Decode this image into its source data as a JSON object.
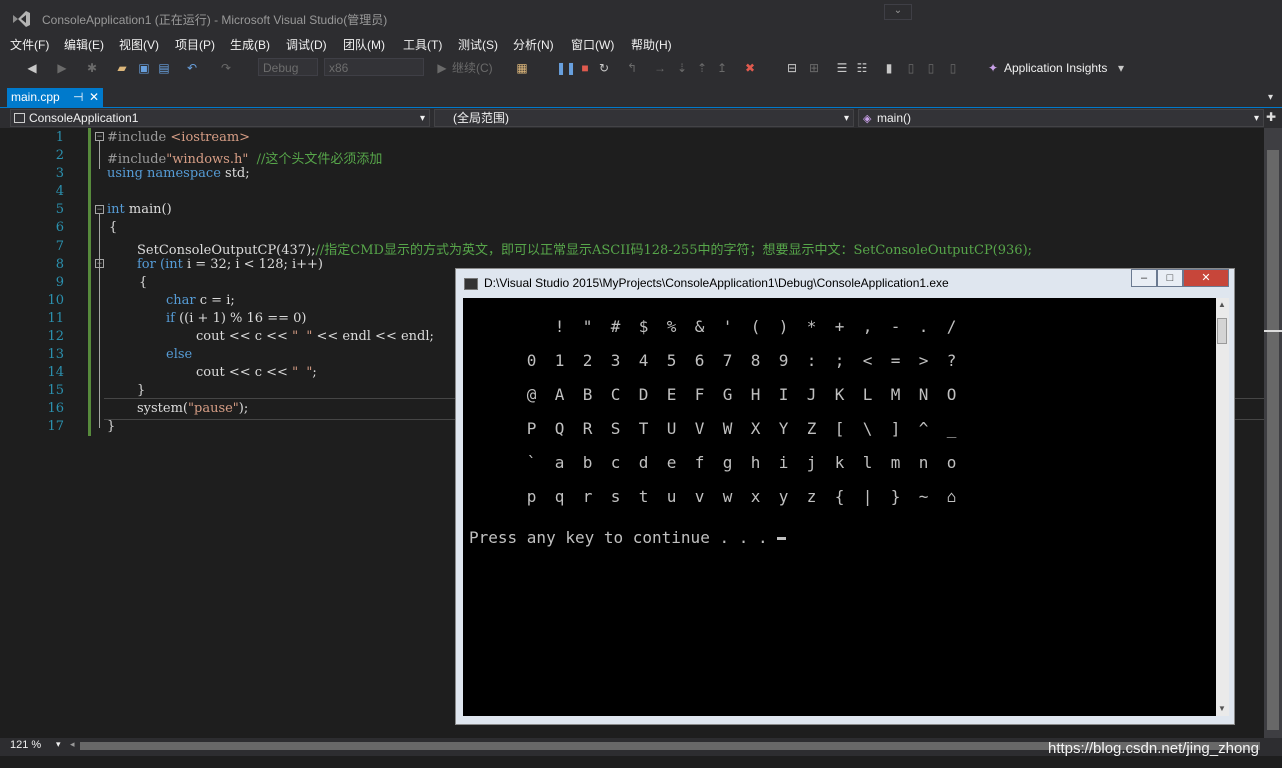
{
  "window": {
    "title": "ConsoleApplication1 (正在运行) - Microsoft Visual Studio(管理员)",
    "collapse_glyph": "⌄"
  },
  "menu": [
    "文件(F)",
    "编辑(E)",
    "视图(V)",
    "项目(P)",
    "生成(B)",
    "调试(D)",
    "团队(M)",
    "工具(T)",
    "测试(S)",
    "分析(N)",
    "窗口(W)",
    "帮助(H)"
  ],
  "toolbar": {
    "config": "Debug",
    "platform": "x86",
    "continue_label": "继续(C)",
    "app_insights": "Application Insights",
    "icons": [
      "back-icon",
      "forward-icon",
      "new-project-icon",
      "open-file-icon",
      "save-icon",
      "save-all-icon",
      "undo-icon",
      "redo-icon",
      "continue-icon",
      "process-icon",
      "pause-icon",
      "stop-icon",
      "restart-icon",
      "step-icon",
      "breakpoint-icon",
      "bookmark-icon",
      "lightbulb-icon"
    ]
  },
  "tab": {
    "label": "main.cpp",
    "pin": "⊣",
    "close": "✕"
  },
  "navbar": {
    "project": "ConsoleApplication1",
    "scope": "(全局范围)",
    "member": "main()"
  },
  "editor": {
    "line_numbers": [
      "1",
      "2",
      "3",
      "4",
      "5",
      "6",
      "7",
      "8",
      "9",
      "10",
      "11",
      "12",
      "13",
      "14",
      "15",
      "16",
      "17"
    ],
    "lines": [
      {
        "text_a": "#include ",
        "text_b": "<iostream>"
      },
      {
        "text_a": "#include",
        "text_b": "\"windows.h\"",
        "text_c": "  //这个头文件必须添加"
      },
      {
        "text_a": "using namespace ",
        "text_b": "std;"
      },
      {
        "text_a": ""
      },
      {
        "text_a": "int ",
        "text_b": "main()"
      },
      {
        "text_a": "{"
      },
      {
        "text_a": "SetConsoleOutputCP(437);",
        "text_b": "//指定CMD显示的方式为英文，即可以正常显示ASCII码128-255中的字符；想要显示中文：SetConsoleOutputCP(936);"
      },
      {
        "text_a": "for ",
        "text_b": "(int ",
        "text_c": "i = 32; i < 128; i++)"
      },
      {
        "text_a": "{"
      },
      {
        "text_a": "char ",
        "text_b": "c = i;"
      },
      {
        "text_a": "if ",
        "text_b": "((i + 1) % 16 == 0)"
      },
      {
        "text_a": "cout << c << ",
        "text_b": "\"  \"",
        "text_c": " << endl << endl;"
      },
      {
        "text_a": "else"
      },
      {
        "text_a": "cout << c << ",
        "text_b": "\"  \"",
        "text_c": ";"
      },
      {
        "text_a": "}"
      },
      {
        "text_a": "system(",
        "text_b": "\"pause\"",
        "text_c": ");"
      },
      {
        "text_a": "}"
      }
    ]
  },
  "zoom": "121 %",
  "console": {
    "title": "D:\\Visual Studio 2015\\MyProjects\\ConsoleApplication1\\Debug\\ConsoleApplication1.exe",
    "buttons": [
      "‒",
      "□",
      "✕"
    ],
    "rows": [
      [
        " ",
        "!",
        "\"",
        "#",
        "$",
        "%",
        "&",
        "'",
        "(",
        ")",
        "*",
        "+",
        ",",
        "-",
        ".",
        "/"
      ],
      [
        "0",
        "1",
        "2",
        "3",
        "4",
        "5",
        "6",
        "7",
        "8",
        "9",
        ":",
        ";",
        "<",
        "=",
        ">",
        "?"
      ],
      [
        "@",
        "A",
        "B",
        "C",
        "D",
        "E",
        "F",
        "G",
        "H",
        "I",
        "J",
        "K",
        "L",
        "M",
        "N",
        "O"
      ],
      [
        "P",
        "Q",
        "R",
        "S",
        "T",
        "U",
        "V",
        "W",
        "X",
        "Y",
        "Z",
        "[",
        "\\",
        "]",
        "^",
        "_"
      ],
      [
        "`",
        "a",
        "b",
        "c",
        "d",
        "e",
        "f",
        "g",
        "h",
        "i",
        "j",
        "k",
        "l",
        "m",
        "n",
        "o"
      ],
      [
        "p",
        "q",
        "r",
        "s",
        "t",
        "u",
        "v",
        "w",
        "x",
        "y",
        "z",
        "{",
        "|",
        "}",
        "~",
        "⌂"
      ]
    ],
    "prompt": "Press any key to continue . . . "
  },
  "watermark": "https://blog.csdn.net/jing_zhong"
}
